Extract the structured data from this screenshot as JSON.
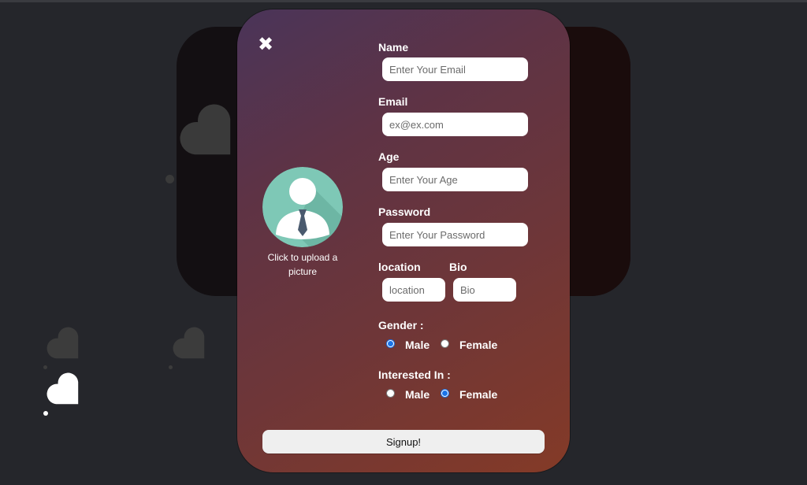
{
  "form": {
    "close_icon": "close-icon",
    "avatar_icon": "user-avatar-icon",
    "upload_label": "Click to upload a picture",
    "name": {
      "label": "Name",
      "placeholder": "Enter Your Email"
    },
    "email": {
      "label": "Email",
      "placeholder": "ex@ex.com"
    },
    "age": {
      "label": "Age",
      "placeholder": "Enter Your Age"
    },
    "password": {
      "label": "Password",
      "placeholder": "Enter Your Password"
    },
    "location": {
      "label": "location",
      "placeholder": "location"
    },
    "bio": {
      "label": "Bio",
      "placeholder": "Bio"
    },
    "gender": {
      "label": "Gender :",
      "options": [
        {
          "label": "Male",
          "checked": true
        },
        {
          "label": "Female",
          "checked": false
        }
      ]
    },
    "interested_in": {
      "label": "Interested In :",
      "options": [
        {
          "label": "Male",
          "checked": false
        },
        {
          "label": "Female",
          "checked": true
        }
      ]
    },
    "submit_label": "Signup!"
  },
  "colors": {
    "page_bg": "#25262b",
    "accent_radio": "#1a73e8",
    "avatar_bg": "#7ec8b6",
    "modal_gradient_start": "#4a3459",
    "modal_gradient_end": "#843a27"
  }
}
